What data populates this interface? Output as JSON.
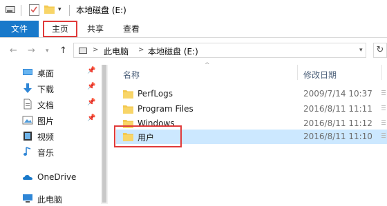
{
  "window": {
    "title": "本地磁盘 (E:)"
  },
  "ribbon": {
    "tabs": [
      {
        "label": "文件"
      },
      {
        "label": "主页"
      },
      {
        "label": "共享"
      },
      {
        "label": "查看"
      }
    ]
  },
  "address": {
    "breadcrumb": [
      "此电脑",
      "本地磁盘 (E:)"
    ],
    "separator": ">"
  },
  "nav": {
    "items": [
      {
        "label": "桌面",
        "icon": "desktop-icon",
        "pinned": true
      },
      {
        "label": "下载",
        "icon": "download-icon",
        "pinned": true
      },
      {
        "label": "文档",
        "icon": "document-icon",
        "pinned": true
      },
      {
        "label": "图片",
        "icon": "picture-icon",
        "pinned": true
      },
      {
        "label": "视频",
        "icon": "video-icon",
        "pinned": false
      },
      {
        "label": "音乐",
        "icon": "music-icon",
        "pinned": false
      },
      {
        "label": "OneDrive",
        "icon": "cloud-icon",
        "pinned": false
      },
      {
        "label": "此电脑",
        "icon": "computer-icon",
        "pinned": false
      }
    ]
  },
  "files": {
    "columns": {
      "name": "名称",
      "modified": "修改日期"
    },
    "rows": [
      {
        "name": "PerfLogs",
        "modified": "2009/7/14 10:37"
      },
      {
        "name": "Program Files",
        "modified": "2016/8/11 11:11"
      },
      {
        "name": "Windows",
        "modified": "2016/8/11 11:12"
      },
      {
        "name": "用户",
        "modified": "2016/8/11 11:10",
        "selected": true
      }
    ]
  },
  "colors": {
    "accent": "#1979ca",
    "highlight": "#e03a3a",
    "selection": "#cce8ff",
    "folder": "#f3c850"
  }
}
